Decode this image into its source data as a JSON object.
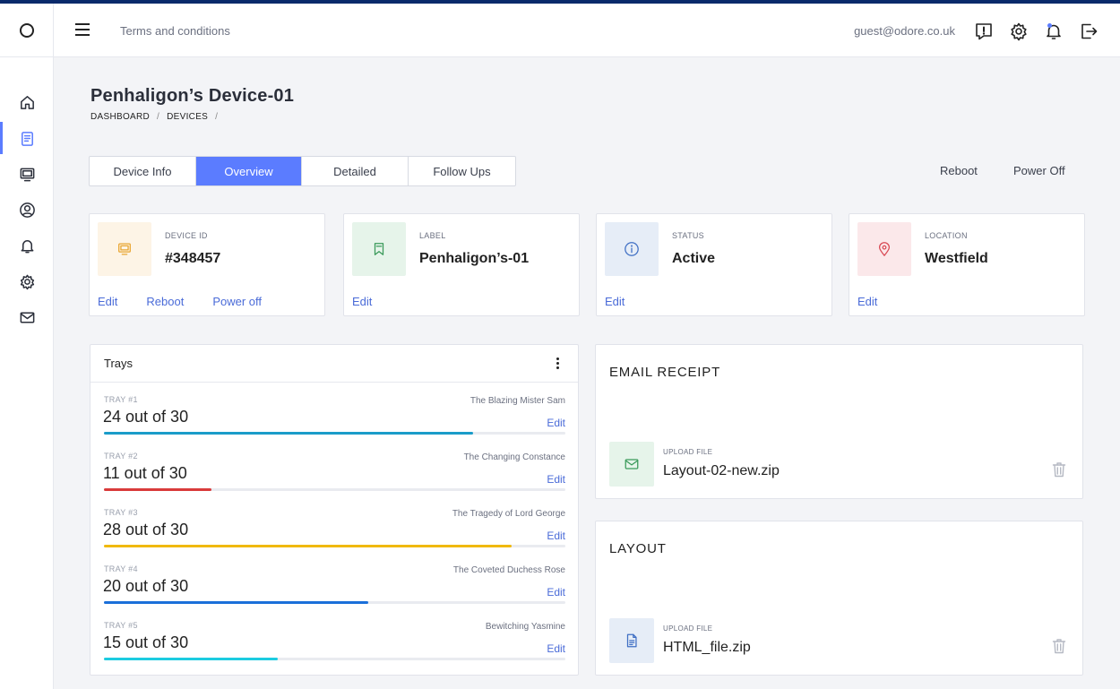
{
  "topbar": {
    "terms_link": "Terms and conditions",
    "user_email": "guest@odore.co.uk"
  },
  "page": {
    "title": "Penhaligon’s Device-01",
    "breadcrumb": [
      "DASHBOARD",
      "DEVICES"
    ]
  },
  "tabs": [
    "Device Info",
    "Overview",
    "Detailed",
    "Follow Ups"
  ],
  "active_tab": "Overview",
  "header_actions": {
    "reboot": "Reboot",
    "power_off": "Power Off"
  },
  "cards": [
    {
      "label": "DEVICE ID",
      "value": "#348457",
      "icon": "monitor-icon",
      "color": "#e8a530",
      "bg": "#fdf4e6",
      "actions": [
        "Edit",
        "Reboot",
        "Power off"
      ]
    },
    {
      "label": "LABEL",
      "value": "Penhaligon’s-01",
      "icon": "bookmark-icon",
      "color": "#3a9a5a",
      "bg": "#e6f4ea",
      "actions": [
        "Edit"
      ]
    },
    {
      "label": "STATUS",
      "value": "Active",
      "icon": "info-icon",
      "color": "#3f6fc4",
      "bg": "#e6edf7",
      "actions": [
        "Edit"
      ]
    },
    {
      "label": "LOCATION",
      "value": "Westfield",
      "icon": "map-pin-icon",
      "color": "#d94a55",
      "bg": "#fbe8ea",
      "actions": [
        "Edit"
      ]
    }
  ],
  "trays": {
    "title": "Trays",
    "items": [
      {
        "num": "TRAY #1",
        "count": "24 out of 30",
        "name": "The Blazing Mister Sam",
        "fill": 0.8,
        "color": "#1a9cc9",
        "edit": "Edit"
      },
      {
        "num": "TRAY #2",
        "count": "11 out of 30",
        "name": "The Changing Constance",
        "fill": 0.2333,
        "color": "#d93a3a",
        "edit": "Edit"
      },
      {
        "num": "TRAY #3",
        "count": "28 out of 30",
        "name": "The Tragedy of Lord George",
        "fill": 0.8833,
        "color": "#f0b90c",
        "edit": "Edit"
      },
      {
        "num": "TRAY #4",
        "count": "20 out of 30",
        "name": "The Coveted Duchess Rose",
        "fill": 0.5733,
        "color": "#1a6fd9",
        "edit": "Edit"
      },
      {
        "num": "TRAY #5",
        "count": "15 out of 30",
        "name": "Bewitching Yasmine",
        "fill": 0.3767,
        "color": "#1ccbe0",
        "edit": "Edit"
      }
    ]
  },
  "files": [
    {
      "title": "EMAIL RECEIPT",
      "label": "UPLOAD FILE",
      "name": "Layout-02-new.zip",
      "icon": "mail-icon",
      "color": "#3a9a5a",
      "bg": "#e6f4ea"
    },
    {
      "title": "LAYOUT",
      "label": "UPLOAD FILE",
      "name": "HTML_file.zip",
      "icon": "document-icon",
      "color": "#3f6fc4",
      "bg": "#e6edf7"
    }
  ]
}
